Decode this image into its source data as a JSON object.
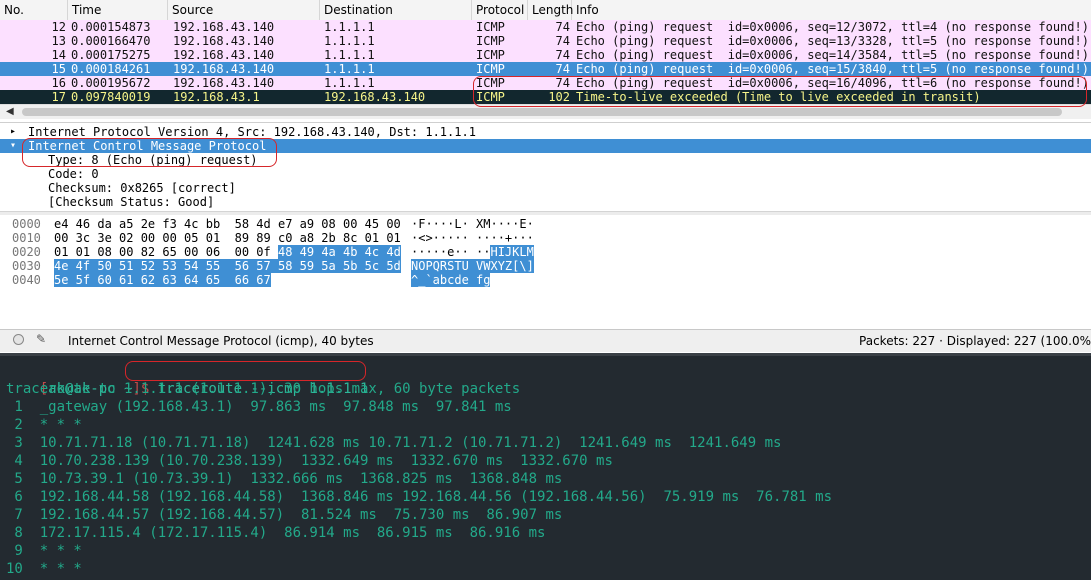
{
  "packet_list": {
    "columns": [
      "No.",
      "Time",
      "Source",
      "Destination",
      "Protocol",
      "Length",
      "Info"
    ],
    "rows": [
      {
        "no": "12",
        "time": "0.000154873",
        "source": "192.168.43.140",
        "destination": "1.1.1.1",
        "protocol": "ICMP",
        "length": "74",
        "info": "Echo (ping) request  id=0x0006, seq=12/3072, ttl=4 (no response found!)",
        "state": "normal"
      },
      {
        "no": "13",
        "time": "0.000166470",
        "source": "192.168.43.140",
        "destination": "1.1.1.1",
        "protocol": "ICMP",
        "length": "74",
        "info": "Echo (ping) request  id=0x0006, seq=13/3328, ttl=5 (no response found!)",
        "state": "normal"
      },
      {
        "no": "14",
        "time": "0.000175275",
        "source": "192.168.43.140",
        "destination": "1.1.1.1",
        "protocol": "ICMP",
        "length": "74",
        "info": "Echo (ping) request  id=0x0006, seq=14/3584, ttl=5 (no response found!)",
        "state": "normal"
      },
      {
        "no": "15",
        "time": "0.000184261",
        "source": "192.168.43.140",
        "destination": "1.1.1.1",
        "protocol": "ICMP",
        "length": "74",
        "info": "Echo (ping) request  id=0x0006, seq=15/3840, ttl=5 (no response found!)",
        "state": "selected"
      },
      {
        "no": "16",
        "time": "0.000195672",
        "source": "192.168.43.140",
        "destination": "1.1.1.1",
        "protocol": "ICMP",
        "length": "74",
        "info": "Echo (ping) request  id=0x0006, seq=16/4096, ttl=6 (no response found!)",
        "state": "normal"
      },
      {
        "no": "17",
        "time": "0.097840019",
        "source": "192.168.43.1",
        "destination": "192.168.43.140",
        "protocol": "ICMP",
        "length": "102",
        "info": "Time-to-live exceeded (Time to live exceeded in transit)",
        "state": "error"
      }
    ]
  },
  "details": {
    "lines": [
      {
        "text": "Internet Protocol Version 4, Src: 192.168.43.140, Dst: 1.1.1.1",
        "expander": "▸",
        "selected": false
      },
      {
        "text": "Internet Control Message Protocol",
        "expander": "▾",
        "selected": true
      },
      {
        "text": "Type: 8 (Echo (ping) request)",
        "expander": "",
        "selected": false
      },
      {
        "text": "Code: 0",
        "expander": "",
        "selected": false
      },
      {
        "text": "Checksum: 0x8265 [correct]",
        "expander": "",
        "selected": false
      },
      {
        "text": "[Checksum Status: Good]",
        "expander": "",
        "selected": false
      }
    ]
  },
  "bytes": {
    "rows": [
      {
        "offset": "0000",
        "hex_plain": "e4 46 da a5 2e f3 4c bb  58 4d e7 a9 08 00 45 00",
        "hex_hl": "",
        "ascii_plain": "·F····L· XM····E·",
        "ascii_hl": ""
      },
      {
        "offset": "0010",
        "hex_plain": "00 3c 3e 02 00 00 05 01  89 89 c0 a8 2b 8c 01 01",
        "hex_hl": "",
        "ascii_plain": "·<>····· ····+···",
        "ascii_hl": ""
      },
      {
        "offset": "0020",
        "hex_plain": "01 01 08 00 82 65 00 06  00 0f ",
        "hex_hl": "48 49 4a 4b 4c 4d",
        "ascii_plain": "·····e·· ··",
        "ascii_hl": "HIJKLM"
      },
      {
        "offset": "0030",
        "hex_plain": "",
        "hex_hl": "4e 4f 50 51 52 53 54 55  56 57 58 59 5a 5b 5c 5d",
        "ascii_plain": "",
        "ascii_hl": "NOPQRSTU VWXYZ[\\]"
      },
      {
        "offset": "0040",
        "hex_plain": "",
        "hex_hl": "5e 5f 60 61 62 63 64 65  66 67",
        "ascii_plain": "",
        "ascii_hl": "^_`abcde fg"
      }
    ]
  },
  "statusbar": {
    "text": "Internet Control Message Protocol (icmp), 40 bytes",
    "right": "Packets: 227 · Displayed: 227 (100.0%"
  },
  "terminal": {
    "prompt_open": "[",
    "prompt_user": "ak@ak-pc ~",
    "prompt_close": "]$ ",
    "command": "traceroute --icmp 1.1.1.1",
    "lines": [
      "traceroute to 1.1.1.1 (1.1.1.1), 30 hops max, 60 byte packets",
      " 1  _gateway (192.168.43.1)  97.863 ms  97.848 ms  97.841 ms",
      " 2  * * *",
      " 3  10.71.71.18 (10.71.71.18)  1241.628 ms 10.71.71.2 (10.71.71.2)  1241.649 ms  1241.649 ms",
      " 4  10.70.238.139 (10.70.238.139)  1332.649 ms  1332.670 ms  1332.670 ms",
      " 5  10.73.39.1 (10.73.39.1)  1332.666 ms  1368.825 ms  1368.848 ms",
      " 6  192.168.44.58 (192.168.44.58)  1368.846 ms 192.168.44.56 (192.168.44.56)  75.919 ms  76.781 ms",
      " 7  192.168.44.57 (192.168.44.57)  81.524 ms  75.730 ms  86.907 ms",
      " 8  172.17.115.4 (172.17.115.4)  86.914 ms  86.915 ms  86.916 ms",
      " 9  * * *",
      "10  * * *"
    ]
  },
  "colors": {
    "row_normal_bg": "#fce0ff",
    "row_selected_bg": "#3f8fd4",
    "row_error_bg": "#12272e",
    "row_error_fg": "#f7f58a",
    "details_selected_bg": "#3f8fd4",
    "terminal_bg": "#232a30",
    "terminal_fg": "#23a98a",
    "annotation_red": "#d6262a"
  }
}
